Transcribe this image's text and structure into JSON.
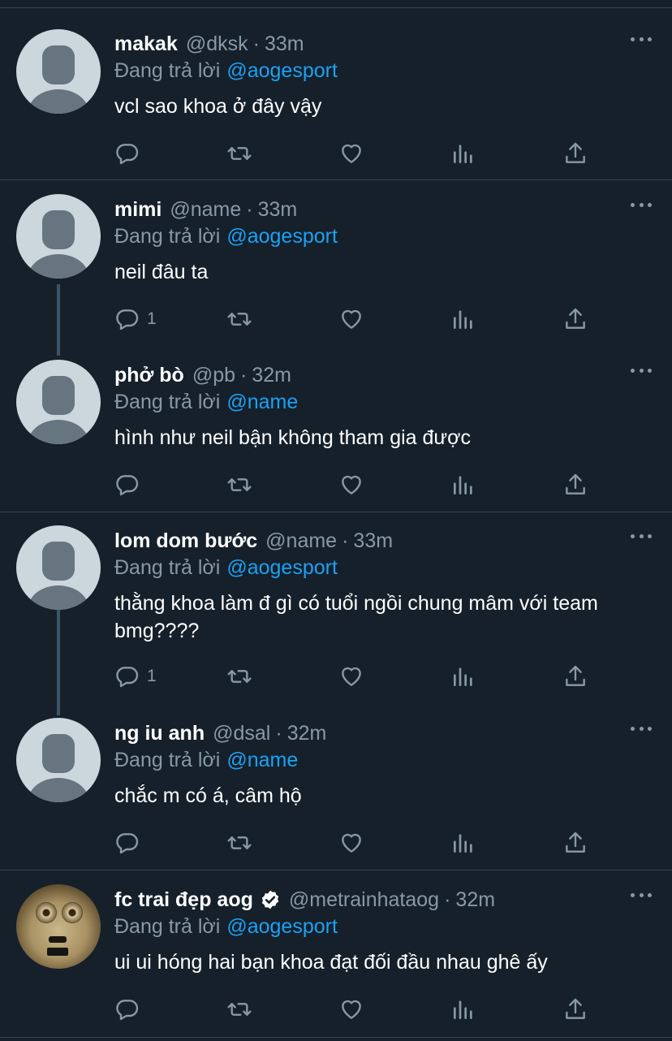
{
  "reply_prefix": "Đang trả lời",
  "tweets": [
    {
      "name": "makak",
      "handle": "@dksk",
      "time": "33m",
      "reply_to": "@aogesport",
      "text": "vcl sao khoa ở đây vậy",
      "reply_count": ""
    },
    {
      "name": "mimi",
      "handle": "@name",
      "time": "33m",
      "reply_to": "@aogesport",
      "text": "neil đâu ta",
      "reply_count": "1"
    },
    {
      "name": "phở bò",
      "handle": "@pb",
      "time": "32m",
      "reply_to": "@name",
      "text": "hình như neil bận không tham gia được",
      "reply_count": ""
    },
    {
      "name": "lom dom bước",
      "handle": "@name",
      "time": "33m",
      "reply_to": "@aogesport",
      "text": "thằng khoa làm đ gì có tuổi ngồi chung mâm với team bmg????",
      "reply_count": "1"
    },
    {
      "name": "ng iu anh",
      "handle": "@dsal",
      "time": "32m",
      "reply_to": "@name",
      "text": "chắc m có á, câm hộ",
      "reply_count": ""
    },
    {
      "name": "fc trai đẹp aog",
      "handle": "@metrainhataog",
      "time": "32m",
      "reply_to": "@aogesport",
      "text": "ui ui hóng hai bạn khoa đạt đối đầu nhau ghê ấy",
      "reply_count": "",
      "verified": true
    }
  ],
  "icons": {
    "reply": "reply-icon",
    "retweet": "retweet-icon",
    "like": "heart-icon",
    "analytics": "analytics-icon",
    "share": "share-icon",
    "more": "more-icon",
    "verified": "verified-badge-icon"
  },
  "colors": {
    "background": "#15202b",
    "mention": "#1da1f2",
    "secondary_text": "#8899a6",
    "divider": "#38444d"
  }
}
